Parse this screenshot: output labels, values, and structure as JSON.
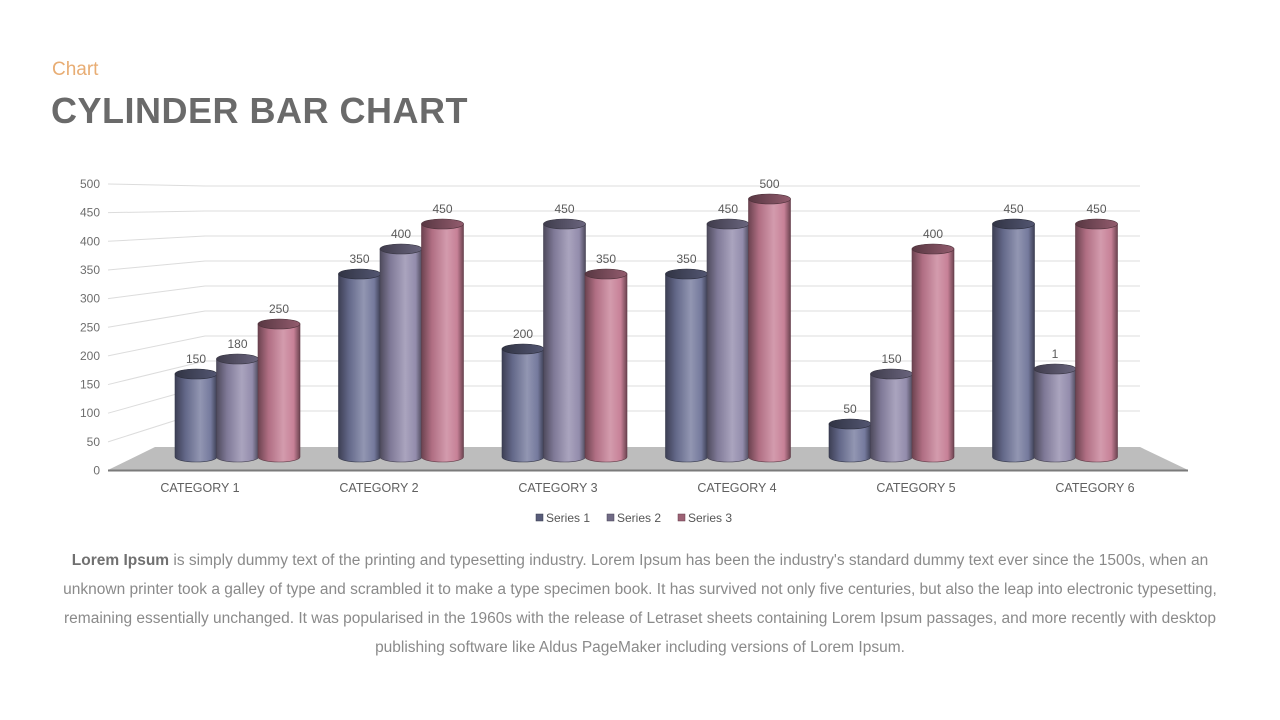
{
  "header": {
    "eyebrow": "Chart",
    "title": "CYLINDER BAR CHART"
  },
  "chart_data": {
    "type": "bar",
    "style": "3d-cylinder",
    "title": "",
    "xlabel": "",
    "ylabel": "",
    "ylim": [
      0,
      500
    ],
    "yticks": [
      0,
      50,
      100,
      150,
      200,
      250,
      300,
      350,
      400,
      450,
      500
    ],
    "grid": true,
    "legend_position": "bottom",
    "categories": [
      "CATEGORY  1",
      "CATEGORY  2",
      "CATEGORY  3",
      "CATEGORY  4",
      "CATEGORY  5",
      "CATEGORY  6"
    ],
    "series": [
      {
        "name": "Series 1",
        "color": "#6e7398",
        "values": [
          150,
          350,
          200,
          350,
          50,
          450
        ]
      },
      {
        "name": "Series 2",
        "color": "#8d86a8",
        "values": [
          180,
          400,
          450,
          450,
          150,
          160
        ]
      },
      {
        "name": "Series 3",
        "color": "#c47a92",
        "values": [
          250,
          450,
          350,
          500,
          400,
          450
        ]
      }
    ],
    "data_labels": [
      [
        "150",
        "350",
        "200",
        "350",
        "50",
        "450"
      ],
      [
        "180",
        "400",
        "450",
        "450",
        "150",
        "1"
      ],
      [
        "250",
        "450",
        "350",
        "500",
        "400",
        "450"
      ]
    ]
  },
  "body": {
    "lead": "Lorem Ipsum",
    "text": " is simply dummy text of the printing and typesetting industry. Lorem Ipsum has been the industry's standard dummy text ever since the 1500s, when an unknown printer took a galley of type and scrambled it to make a type specimen book. It has survived not only five centuries, but also the leap into electronic typesetting, remaining essentially unchanged. It was popularised in the 1960s with the release of Letraset sheets containing Lorem Ipsum passages, and more recently with desktop publishing software like Aldus PageMaker including versions of Lorem Ipsum."
  }
}
